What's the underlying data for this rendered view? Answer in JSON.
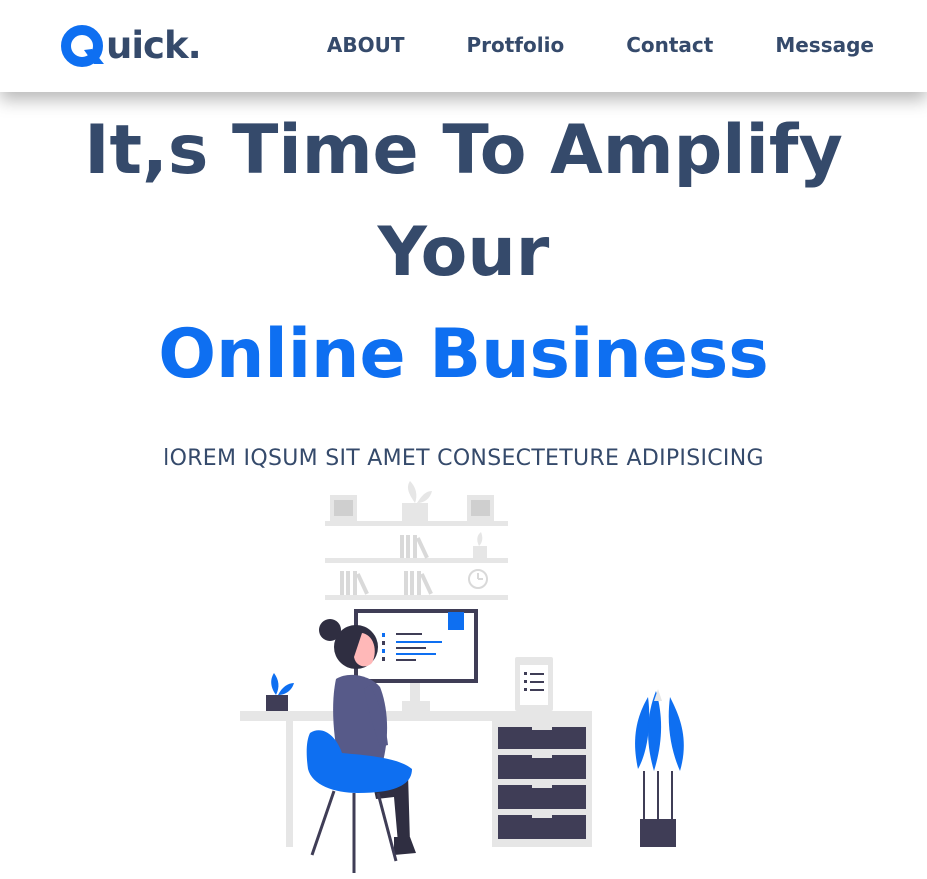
{
  "brand": {
    "name_rest": "uick.",
    "logo_icon": "q-logo-icon",
    "accent_color": "#0e6ff1",
    "text_color": "#354a6b"
  },
  "nav": {
    "items": [
      "ABOUT",
      "Protfolio",
      "Contact",
      "Message"
    ]
  },
  "hero": {
    "line1": "It,s Time To Amplify",
    "line2": "Your",
    "line3": "Online Business",
    "subtitle": "lOREM IQSUM SIT AMET CONSECTETURE ADIPISICING"
  },
  "illustration": {
    "icon": "woman-at-desk-illustration"
  }
}
